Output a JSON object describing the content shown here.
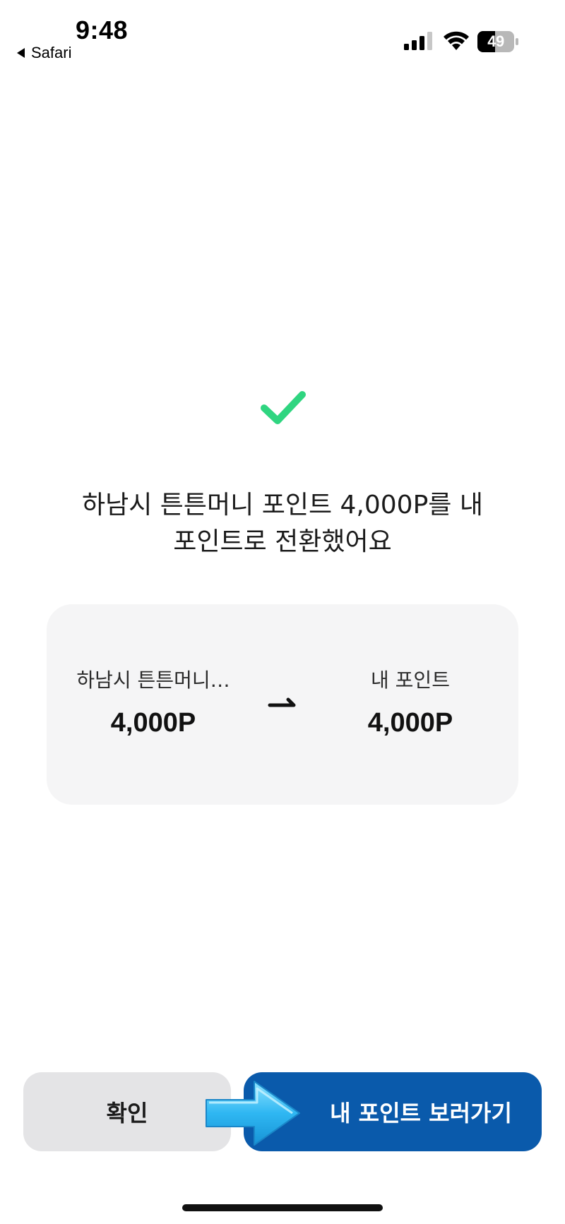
{
  "status_bar": {
    "time": "9:48",
    "back_app_label": "Safari",
    "battery_level": "49",
    "icons": [
      "signal-icon",
      "wifi-icon",
      "battery-icon"
    ]
  },
  "result": {
    "icon": "check-icon",
    "icon_color": "#2fd580",
    "message_line1": "하남시 튼튼머니 포인트 4,000P를 내",
    "message_line2": "포인트로 전환했어요"
  },
  "summary": {
    "from_label": "하남시 튼튼머니…",
    "from_amount": "4,000P",
    "arrow_icon": "arrow-right-icon",
    "to_label": "내 포인트",
    "to_amount": "4,000P"
  },
  "actions": {
    "confirm_label": "확인",
    "view_points_label": "내 포인트 보러가기",
    "accent_color": "#0a5aab"
  }
}
